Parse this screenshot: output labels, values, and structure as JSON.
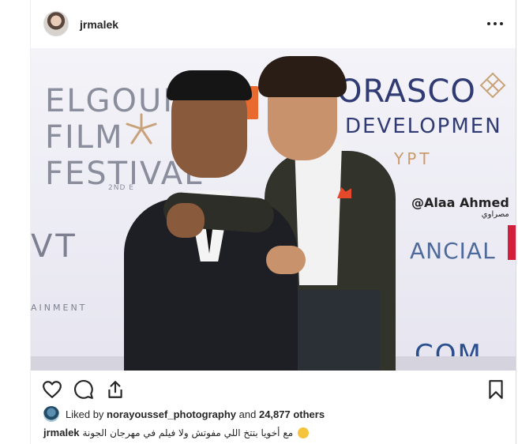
{
  "post": {
    "username": "jrmalek",
    "more_icon": "more-horizontal-icon"
  },
  "photo": {
    "backdrop": {
      "festival_lines": [
        "ELGOUNA",
        "FILM",
        "FESTIVAL"
      ],
      "edition": "2ND E",
      "sponsor_1": "ORASCO",
      "sponsor_1_line2": "DEVELOPMEN",
      "sponsor_1_line3": "YPT",
      "credit": "@Alaa Ahmed",
      "credit_sub": "مصراوي",
      "sponsor_2": "ANCIAL",
      "sponsor_3": "VT",
      "sponsor_3_sub": "AINMENT",
      "sponsor_4": "COM"
    }
  },
  "actions": {
    "like_icon": "heart-icon",
    "comment_icon": "comment-icon",
    "share_icon": "share-icon",
    "save_icon": "bookmark-icon"
  },
  "likes": {
    "prefix": "Liked by",
    "user": "norayoussef_photography",
    "connector": "and",
    "count": "24,877 others"
  },
  "caption": {
    "user": "jrmalek",
    "text": "مع أخويا بتتخ اللي مفوتش ولا فيلم في مهرجان الجونة",
    "emoji": "smiling-face-emoji"
  }
}
